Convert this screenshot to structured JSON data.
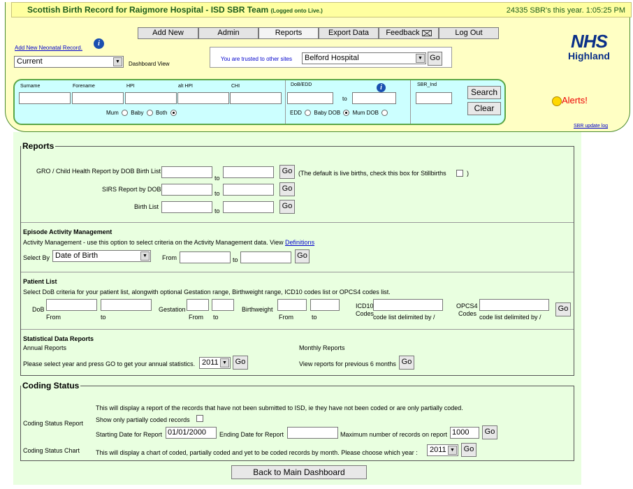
{
  "header": {
    "title": "Scottish Birth Record for Raigmore Hospital - ISD SBR Team",
    "logged": "(Logged onto Live.)",
    "stats": "24335 SBR's this year. 1:05:25 PM"
  },
  "nav": [
    "Add New",
    "Admin",
    "Reports",
    "Export Data",
    "Feedback",
    "Log Out"
  ],
  "add_link": "Add New Neonatal Record.",
  "dashboard": {
    "value": "Current",
    "label": "Dashboard View"
  },
  "trusted": {
    "label": "You are trusted to other sites",
    "value": "Belford Hospital",
    "go": "Go"
  },
  "logo": {
    "nhs": "NHS",
    "region": "Highland"
  },
  "alerts": "Alerts!",
  "sbr_log": "SBR update log",
  "search": {
    "surname": "Surname",
    "forename": "Forename",
    "hpi": "HPI",
    "alt_hpi": "alt HPI",
    "chi": "CHI",
    "dob_edd": "DoB/EDD",
    "to": "to",
    "sbr_ind": "SBR_Ind",
    "mum": "Mum",
    "baby": "Baby",
    "both": "Both",
    "edd": "EDD",
    "baby_dob": "Baby DOB",
    "mum_dob": "Mum DOB",
    "search_btn": "Search",
    "clear_btn": "Clear"
  },
  "reports": {
    "legend": "Reports",
    "gro": "GRO / Child Health Report by DOB Birth List",
    "sirs": "SIRS Report by DOB",
    "birth": "Birth List",
    "to": "to",
    "go": "Go",
    "stillbirth": "(The default is live births, check this box for Stillbirths",
    "stillbirth_end": ")"
  },
  "episode": {
    "title": "Episode Activity Management",
    "desc": "Activity Management - use this option to select criteria on the Activity Management data.  View",
    "def_link": "Definitions",
    "select_by": "Select By",
    "select_val": "Date of Birth",
    "from": "From",
    "to": "to",
    "go": "Go"
  },
  "patient": {
    "title": "Patient List",
    "desc": "Select DoB criteria for your patient list, alongwith optional Gestation range, Birthweight range, ICD10 codes list  or OPCS4 codes list.",
    "dob": "DoB",
    "from": "From",
    "to": "to",
    "gestation": "Gestation",
    "birthweight": "Birthweight",
    "icd10": "ICD10",
    "icd10b": "Codes",
    "code_hint": "code list delimited by /",
    "opcs4": "OPCS4",
    "opcs4b": "Codes",
    "go": "Go"
  },
  "stats": {
    "title": "Statistical Data Reports",
    "annual": "Annual Reports",
    "monthly": "Monthly Reports",
    "annual_desc": "Please select year and press GO to get your annual statistics.",
    "year": "2011",
    "go": "Go",
    "monthly_desc": "View reports for previous 6 months"
  },
  "coding": {
    "legend": "Coding Status",
    "desc": "This will display a report of the records that have not been submitted to ISD, ie they have not been coded or are only partially coded.",
    "report": "Coding Status Report",
    "partial": "Show only partially coded records",
    "start": "Starting Date for Report",
    "start_val": "01/01/2000",
    "end": "Ending Date for Report",
    "max": "Maximum number of records on report",
    "max_val": "1000",
    "go": "Go",
    "chart": "Coding Status Chart",
    "chart_desc": "This will display a chart of coded, partially coded and yet to be coded records by month. Please choose which year :",
    "year": "2011"
  },
  "back": "Back to Main Dashboard"
}
